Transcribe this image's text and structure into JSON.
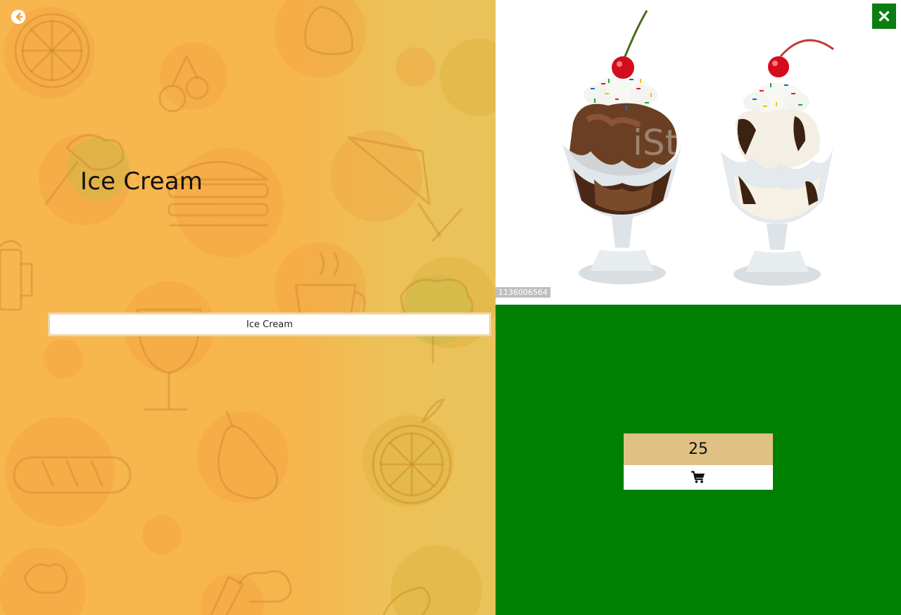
{
  "product": {
    "title": "Ice Cream",
    "name_value": "Ice Cream",
    "price": "25",
    "image_id": "1136006564"
  },
  "icons": {
    "back": "arrow-left-circle-icon",
    "close": "close-icon",
    "cart": "shopping-cart-icon"
  },
  "colors": {
    "left_panel": "#f8b64f",
    "right_bottom": "#008000",
    "close_button": "#0b7d12",
    "price_box": "#dfc183"
  }
}
